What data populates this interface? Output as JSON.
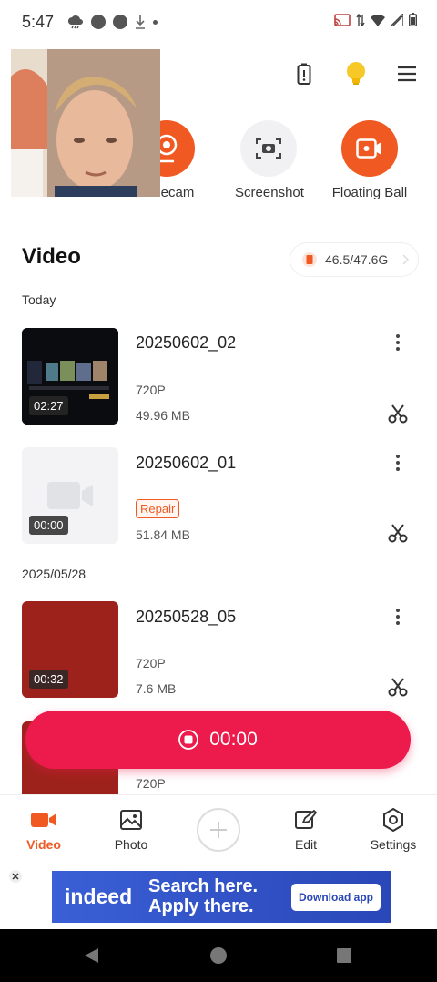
{
  "status_bar": {
    "time": "5:47"
  },
  "quick_actions": [
    {
      "label": "Facecam",
      "visible_label": "ecam"
    },
    {
      "label": "Screenshot"
    },
    {
      "label": "Floating Ball"
    }
  ],
  "section": {
    "title": "Video",
    "storage": "46.5/47.6G"
  },
  "groups": [
    {
      "date": "Today",
      "videos": [
        {
          "name": "20250602_02",
          "resolution": "720P",
          "size": "49.96 MB",
          "duration": "02:27"
        },
        {
          "name": "20250602_01",
          "badge": "Repair",
          "size": "51.84 MB",
          "duration": "00:00"
        }
      ]
    },
    {
      "date": "2025/05/28",
      "videos": [
        {
          "name": "20250528_05",
          "resolution": "720P",
          "size": "7.6 MB",
          "duration": "00:32"
        },
        {
          "resolution": "720P"
        }
      ]
    }
  ],
  "record": {
    "timer": "00:00"
  },
  "bottom_nav": [
    {
      "label": "Video",
      "active": true
    },
    {
      "label": "Photo"
    },
    {
      "label": "Edit"
    },
    {
      "label": "Settings"
    }
  ],
  "ad": {
    "brand": "indeed",
    "line1": "Search here.",
    "line2": "Apply there.",
    "cta": "Download app"
  },
  "colors": {
    "accent": "#f05a22",
    "record": "#ec1b4b",
    "ad": "#2a47b8"
  }
}
